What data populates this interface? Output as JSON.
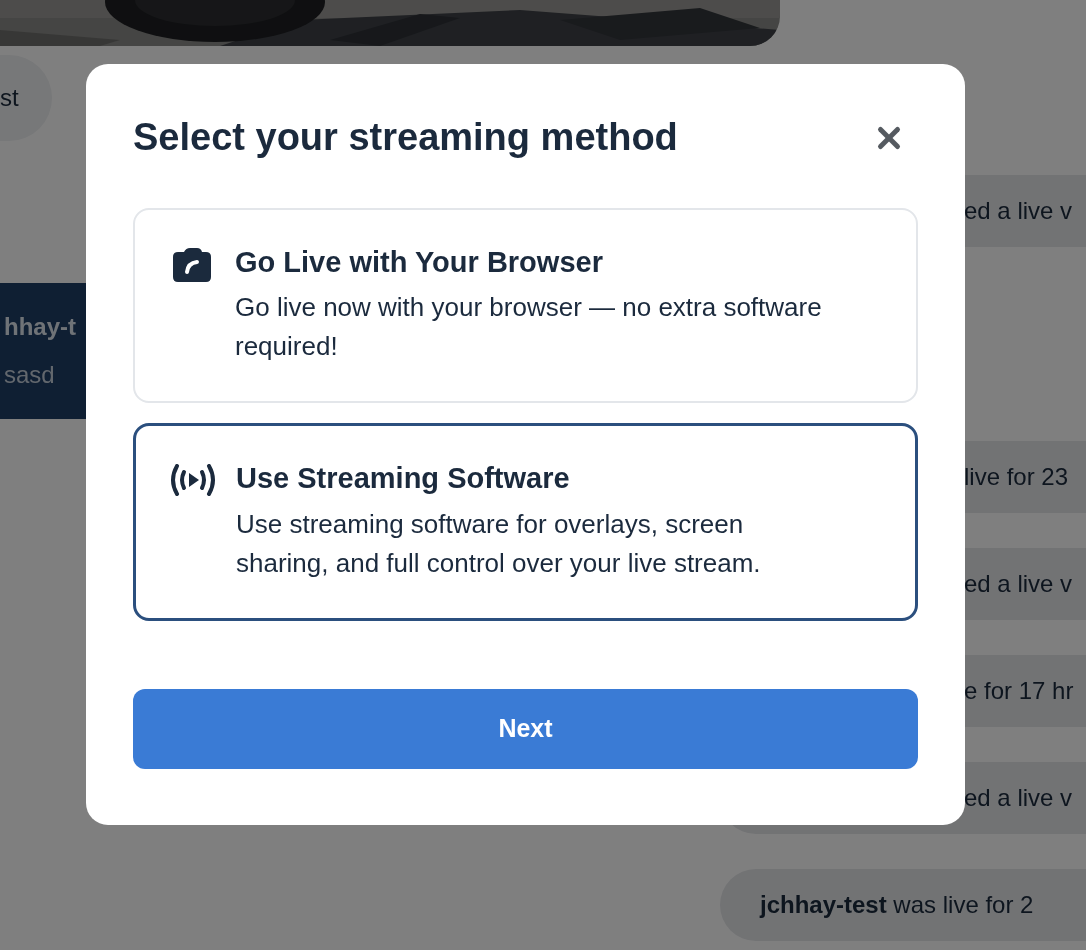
{
  "background": {
    "left_pill": "st",
    "left_card": {
      "name": "hhay-t",
      "message": "sasd"
    },
    "activity": [
      {
        "kind": "partial",
        "text": "ed a live v"
      },
      {
        "kind": "partial",
        "text": "live for 23"
      },
      {
        "kind": "partial",
        "text": "ed a live v"
      },
      {
        "kind": "partial",
        "text": "e for 17 hr"
      },
      {
        "kind": "partial",
        "text": "ed a live v"
      },
      {
        "kind": "full",
        "text": "**jchhay-test** was live for 2"
      }
    ]
  },
  "dialog": {
    "title": "Select your streaming method",
    "options": [
      {
        "kind": "browser",
        "title": "Go Live with Your Browser",
        "description": "Go live now with your browser — no extra software required!",
        "selected": false
      },
      {
        "kind": "software",
        "title": "Use Streaming Software",
        "description": "Use streaming software for overlays, screen sharing, and full control over your live stream.",
        "selected": true
      }
    ],
    "button": "Next"
  }
}
